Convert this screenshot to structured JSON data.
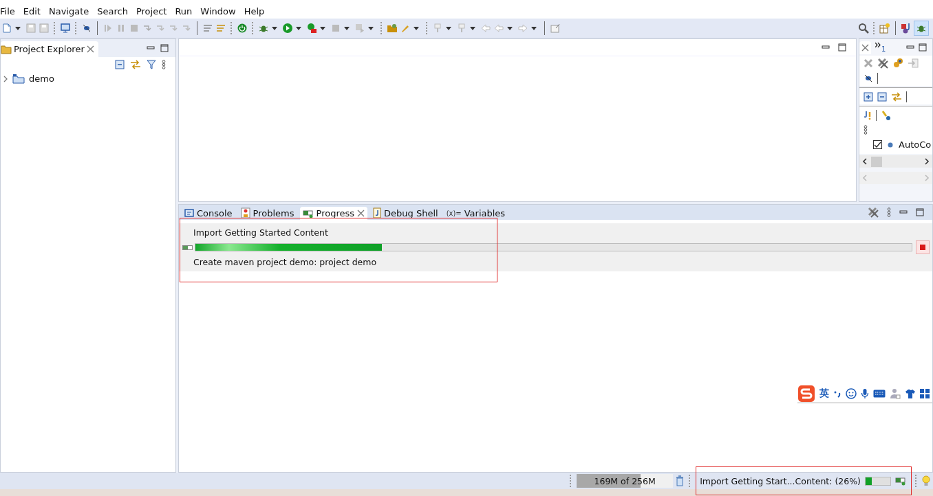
{
  "menu": [
    "File",
    "Edit",
    "Navigate",
    "Search",
    "Project",
    "Run",
    "Window",
    "Help"
  ],
  "project_explorer": {
    "title": "Project Explorer",
    "tree": [
      {
        "label": "demo",
        "expanded": false
      }
    ]
  },
  "outline_panel": {
    "overflow_count": "1",
    "items": [
      {
        "label": "AutoCo",
        "checked": true
      }
    ]
  },
  "bottom_panel": {
    "tabs": [
      {
        "label": "Console",
        "kind": "console",
        "selected": false
      },
      {
        "label": "Problems",
        "kind": "problems",
        "selected": false
      },
      {
        "label": "Progress",
        "kind": "progress",
        "selected": true
      },
      {
        "label": "Debug Shell",
        "kind": "debug-shell",
        "selected": false
      },
      {
        "label": "Variables",
        "kind": "variables",
        "icon_text": "(x)=",
        "selected": false
      }
    ],
    "jobs": [
      {
        "title": "Import Getting Started Content",
        "level": 0.26,
        "detail": "Create maven project demo: project demo"
      }
    ]
  },
  "status_bar": {
    "memory": {
      "text": "169M of 256M",
      "level": 0.66
    },
    "job": {
      "text": "Import Getting Start...Content: (26%)",
      "level": 0.26
    }
  },
  "ime_toolbar": {
    "mode": "英"
  }
}
